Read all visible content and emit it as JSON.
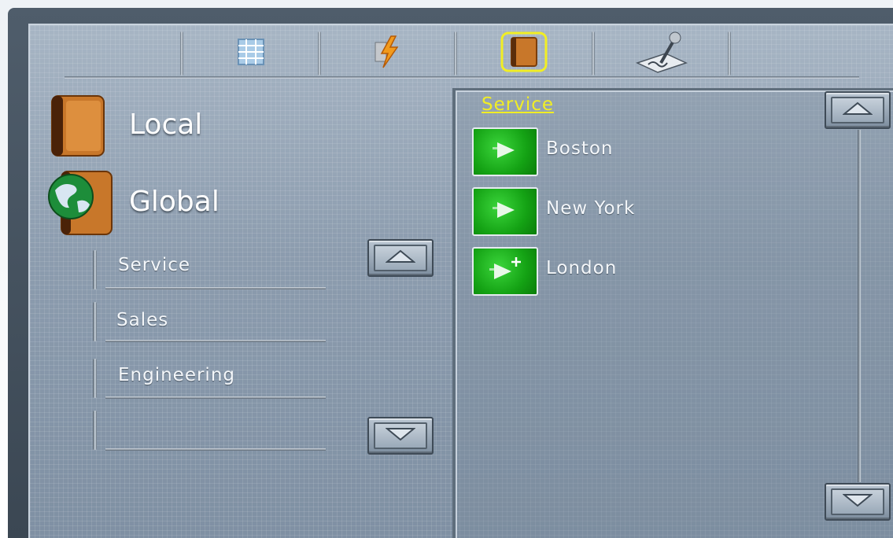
{
  "toolbar": {
    "tabs": [
      {
        "icon": "grid-table-icon",
        "selected": false
      },
      {
        "icon": "lightning-bolt-icon",
        "selected": false
      },
      {
        "icon": "address-book-icon",
        "selected": true
      },
      {
        "icon": "pen-signature-icon",
        "selected": false
      }
    ]
  },
  "left_panel": {
    "categories": [
      {
        "label": "Local",
        "icon": "book-icon"
      },
      {
        "label": "Global",
        "icon": "globe-book-icon"
      }
    ],
    "list": [
      {
        "label": "Service"
      },
      {
        "label": "Sales"
      },
      {
        "label": "Engineering"
      },
      {
        "label": ""
      }
    ]
  },
  "right_panel": {
    "title": "Service",
    "title_color": "#f1ee24",
    "items": [
      {
        "label": "Boston",
        "icon": "play-icon"
      },
      {
        "label": "New York",
        "icon": "play-icon"
      },
      {
        "label": "London",
        "icon": "play-plus-icon"
      }
    ]
  },
  "colors": {
    "accent_yellow": "#f1ee24",
    "button_green": "#14a214",
    "panel_blue": "#8c9db0"
  }
}
